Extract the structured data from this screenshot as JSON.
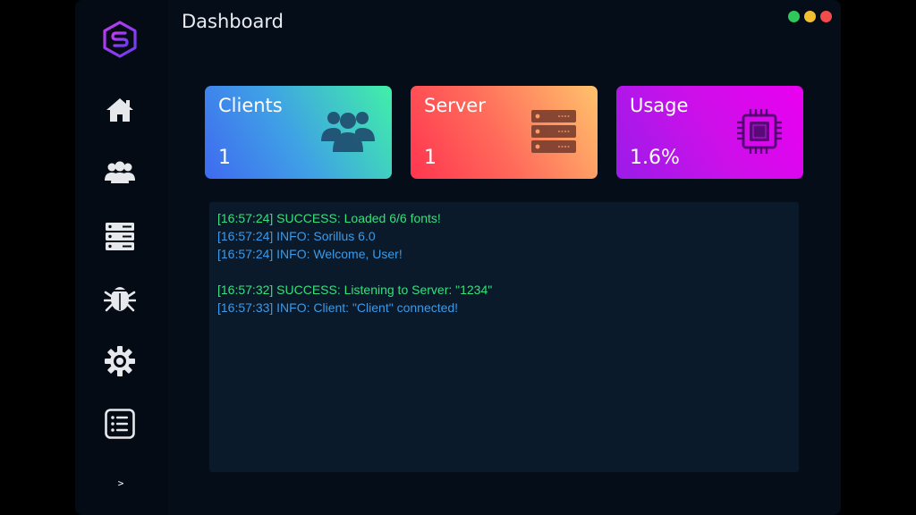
{
  "header": {
    "title": "Dashboard"
  },
  "colors": {
    "close": "#f24b4b",
    "minimize": "#f2c02e",
    "maximize": "#2fc85a",
    "success": "#35e07d",
    "info": "#3b9ae8"
  },
  "sidebar": {
    "items": [
      {
        "id": "home",
        "icon": "home-icon"
      },
      {
        "id": "clients",
        "icon": "users-icon"
      },
      {
        "id": "servers",
        "icon": "server-icon"
      },
      {
        "id": "bug",
        "icon": "bug-icon"
      },
      {
        "id": "settings",
        "icon": "gear-icon"
      },
      {
        "id": "logs",
        "icon": "list-icon"
      }
    ],
    "expand_label": ">"
  },
  "cards": {
    "clients": {
      "title": "Clients",
      "value": "1",
      "icon": "users-icon"
    },
    "server": {
      "title": "Server",
      "value": "1",
      "icon": "server-icon"
    },
    "usage": {
      "title": "Usage",
      "value": "1.6%",
      "icon": "cpu-icon"
    }
  },
  "console": {
    "lines": [
      {
        "type": "success",
        "text": "[16:57:24] SUCCESS: Loaded 6/6 fonts!"
      },
      {
        "type": "info",
        "text": "[16:57:24] INFO: Sorillus 6.0"
      },
      {
        "type": "info",
        "text": "[16:57:24] INFO: Welcome, User!"
      },
      {
        "type": "blank",
        "text": ""
      },
      {
        "type": "success",
        "text": "[16:57:32] SUCCESS: Listening to Server: \"1234\""
      },
      {
        "type": "info",
        "text": "[16:57:33] INFO: Client: \"Client\" connected!"
      }
    ]
  }
}
